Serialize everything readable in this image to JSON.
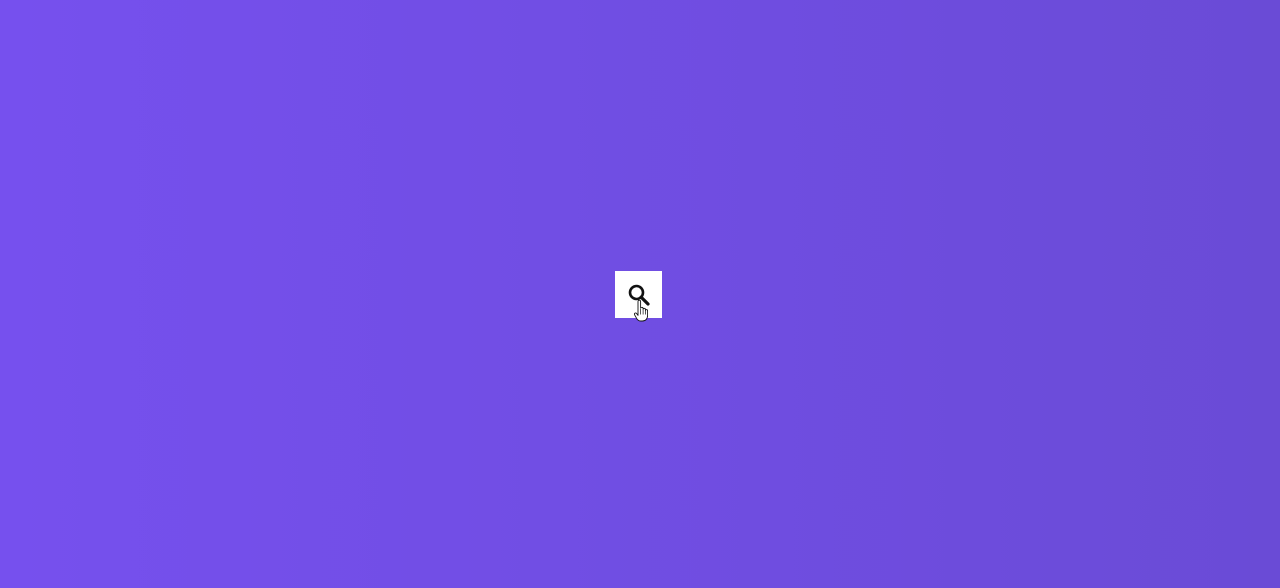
{
  "page": {
    "background_colors": [
      "#7650ee",
      "#6a4bd6"
    ]
  },
  "search_button": {
    "icon": "search-icon",
    "background_color": "#ffffff",
    "icon_color": "#111111"
  },
  "cursor": {
    "icon": "hand-pointer-icon"
  }
}
